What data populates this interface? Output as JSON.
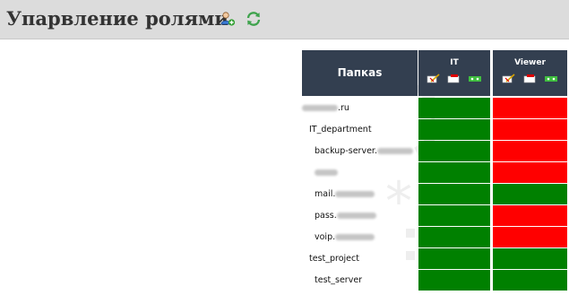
{
  "header": {
    "title": "Упарвление ролями",
    "icons": [
      "add-user-icon",
      "refresh-icon"
    ]
  },
  "table": {
    "folder_header": "Папкаs",
    "roles": [
      {
        "name": "IT"
      },
      {
        "name": "Viewer"
      }
    ],
    "permission_icons": [
      "edit-folder-icon",
      "folder-view-icon",
      "folder-access-icon"
    ],
    "colors": {
      "allowed": "#008000",
      "denied": "#ff0000",
      "header_bg": "#333f50"
    },
    "rows": [
      {
        "label": ".ru",
        "indent": 0,
        "blur_before": true,
        "blur_after": false,
        "it": "allowed",
        "viewer": "denied"
      },
      {
        "label": "IT_department",
        "indent": 1,
        "blur_before": false,
        "blur_after": false,
        "it": "allowed",
        "viewer": "denied"
      },
      {
        "label": "backup-server.",
        "indent": 2,
        "blur_before": false,
        "blur_after": true,
        "it": "allowed",
        "viewer": "denied"
      },
      {
        "label": "",
        "indent": 2,
        "blur_before": true,
        "blur_after": false,
        "it": "allowed",
        "viewer": "denied"
      },
      {
        "label": "mail.",
        "indent": 2,
        "blur_before": false,
        "blur_after": true,
        "it": "allowed",
        "viewer": "allowed"
      },
      {
        "label": "pass.",
        "indent": 2,
        "blur_before": false,
        "blur_after": true,
        "it": "allowed",
        "viewer": "denied"
      },
      {
        "label": "voip.",
        "indent": 2,
        "blur_before": false,
        "blur_after": true,
        "it": "allowed",
        "viewer": "denied"
      },
      {
        "label": "test_project",
        "indent": 1,
        "blur_before": false,
        "blur_after": false,
        "it": "allowed",
        "viewer": "allowed"
      },
      {
        "label": "test_server",
        "indent": 2,
        "blur_before": false,
        "blur_after": false,
        "it": "allowed",
        "viewer": "allowed"
      }
    ]
  }
}
